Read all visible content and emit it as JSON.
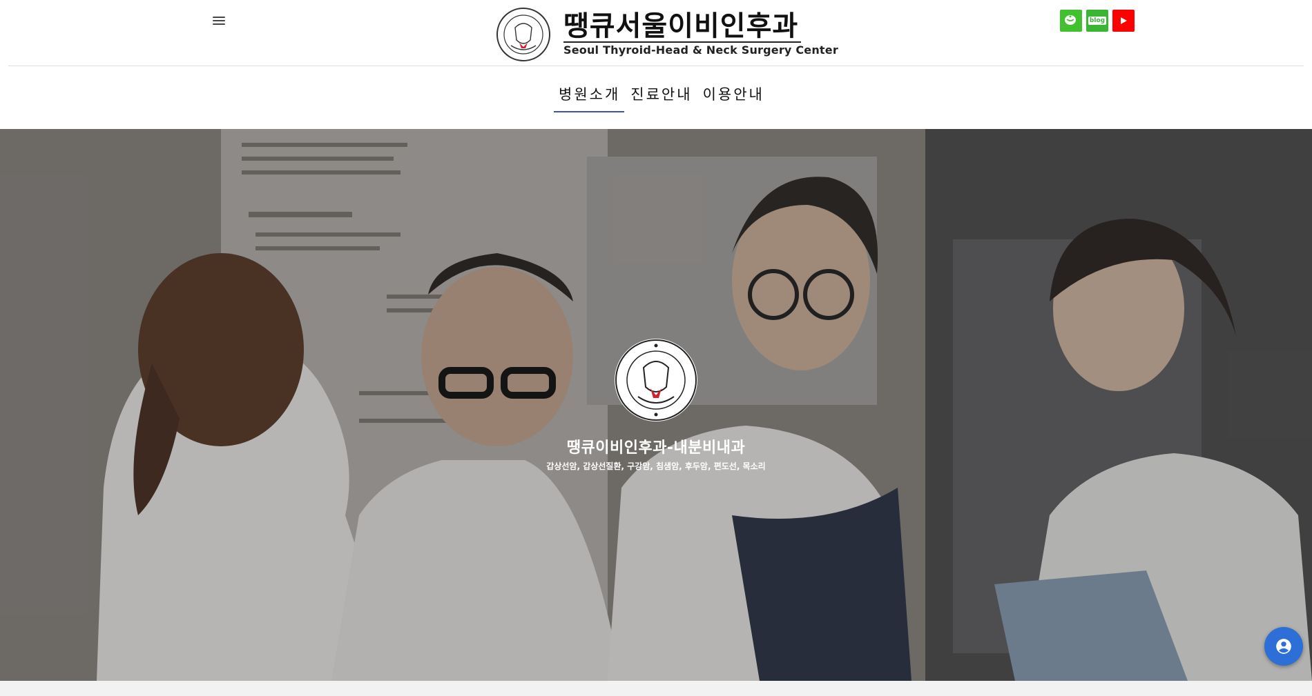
{
  "header": {
    "menu_icon": "hamburger-menu-icon",
    "logo": {
      "title": "땡큐서울이비인후과",
      "subtitle": "Seoul Thyroid-Head & Neck Surgery Center",
      "emblem_icon": "hospital-emblem-icon"
    },
    "social": [
      {
        "name": "cafe",
        "icon": "cafe-cup-icon",
        "color": "#42c12e"
      },
      {
        "name": "blog",
        "label": "blog",
        "icon": "blog-icon",
        "color": "#3bb534"
      },
      {
        "name": "youtube",
        "icon": "play-icon",
        "color": "#ff0000"
      }
    ]
  },
  "nav": {
    "items": [
      {
        "label": "병원소개",
        "active": true
      },
      {
        "label": "진료안내",
        "active": false
      },
      {
        "label": "이용안내",
        "active": false
      }
    ],
    "accent": "#3e4fbf"
  },
  "hero": {
    "title": "땡큐이비인후과-내분비내과",
    "tags": "갑상선암, 갑상선질환, 구강암, 침샘암, 후두암, 편도선, 목소리",
    "emblem_icon": "hospital-emblem-icon"
  },
  "floating": {
    "icon": "account-circle-icon",
    "color": "#2d6fd6"
  }
}
